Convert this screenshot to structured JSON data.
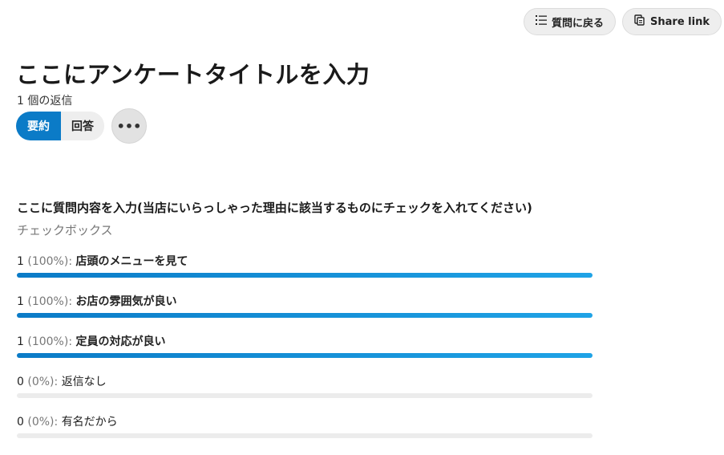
{
  "header": {
    "back_button_label": "質問に戻る",
    "share_button_label": "Share link",
    "title": "ここにアンケートタイトルを入力",
    "reply_count": "1 個の返信"
  },
  "tabs": [
    {
      "label": "要約",
      "active": true
    },
    {
      "label": "回答",
      "active": false
    }
  ],
  "more_label": "•••",
  "question": {
    "title": "ここに質問内容を入力(当店にいらっしゃった理由に該当するものにチェックを入れてください)",
    "type": "チェックボックス",
    "options": [
      {
        "count": "1",
        "percent": "(100%):",
        "label": "店頭のメニューを見て",
        "fraction": 1.0
      },
      {
        "count": "1",
        "percent": "(100%):",
        "label": "お店の雰囲気が良い",
        "fraction": 1.0
      },
      {
        "count": "1",
        "percent": "(100%):",
        "label": "定員の対応が良い",
        "fraction": 1.0
      },
      {
        "count": "0",
        "percent": "(0%):",
        "label": "返信なし",
        "fraction": 0.0
      },
      {
        "count": "0",
        "percent": "(0%):",
        "label": "有名だから",
        "fraction": 0.0
      }
    ]
  },
  "colors": {
    "accent": "#0b7bc7",
    "bar_track": "#ececec"
  },
  "icons": {
    "back": "list-icon",
    "share": "share-link-icon"
  }
}
